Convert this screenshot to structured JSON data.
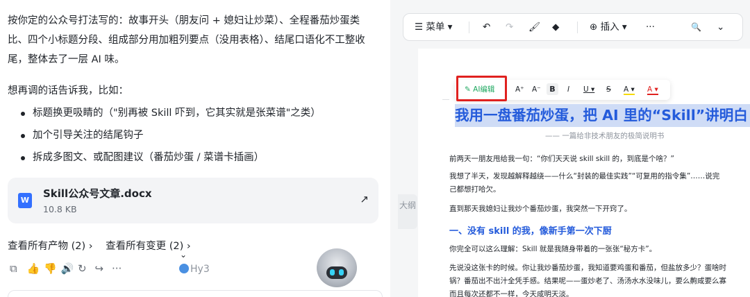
{
  "chat": {
    "paragraph1": "按你定的公众号打法写的：故事开头（朋友问 + 媳妇让炒菜）、全程番茄炒蛋类比、四个小标题分段、组成部分用加粗列要点（没用表格）、结尾口语化不工整收尾，整体去了一层 AI 味。",
    "paragraph2": "想再调的话告诉我，比如：",
    "bullets": [
      "标题换更吸睛的（\"别再被 Skill 吓到，它其实就是张菜谱\"之类）",
      "加个引导关注的结尾钩子",
      "拆成多图文、或配图建议（番茄炒蛋 / 菜谱卡插画）"
    ],
    "file": {
      "icon_letter": "W",
      "name": "Skill公众号文章.docx",
      "size": "10.8 KB",
      "open_glyph": "↗"
    },
    "links": {
      "products": "查看所有产物 (2) ›",
      "changes": "查看所有变更 (2) ›"
    },
    "actions": [
      "⧉",
      "👍",
      "👎",
      "🔊",
      "↻",
      "↪",
      "···"
    ],
    "user_tag": "Hy3",
    "scroll_glyph": "⌄"
  },
  "toolbar": {
    "menu": "☰ 菜单 ▾",
    "undo": "↶",
    "redo": "↷",
    "format_painter": "🖌",
    "eraser": "◆",
    "insert": "⊕ 插入 ▾",
    "more": "···",
    "search": "🔍",
    "collapse": "⌄"
  },
  "outline_label": "大纲",
  "float_bar": {
    "ai_edit": "✎ AI编辑",
    "font_up": "A⁺",
    "font_down": "A⁻",
    "bold": "B",
    "italic": "I",
    "underline": "U ▾",
    "strike": "S",
    "highlight": "A ▾",
    "color": "A ▾"
  },
  "document": {
    "title": "我用一盘番茄炒蛋，把 AI 里的“Skill”讲明白",
    "subtitle": "—— 一篇给非技术朋友的极简说明书",
    "lines": [
      "前两天一朋友甩给我一句：“你们天天说 skill skill 的，到底是个啥？”",
      "我想了半天，发现越解释越绕——什么“封装的最佳实践”“可复用的指令集”……说完",
      "己都想打哈欠。",
      "直到那天我媳妇让我炒个番茄炒蛋，我突然一下开窍了。"
    ],
    "heading1": "一、没有 skill 的我，像新手第一次下厨",
    "lines2": [
      "你完全可以这么理解：Skill 就是我随身带着的一张张“秘方卡”。",
      "先说没这张卡的时候。你让我炒番茄炒蛋，我知道要鸡蛋和番茄，但盐放多少？蛋啥时",
      "锅？番茄出不出汁全凭手感。结果呢——蛋炒老了、汤汤水水没味儿，要么齁咸要么寡",
      "而且每次还都不一样，今天咸明天淡。"
    ]
  }
}
